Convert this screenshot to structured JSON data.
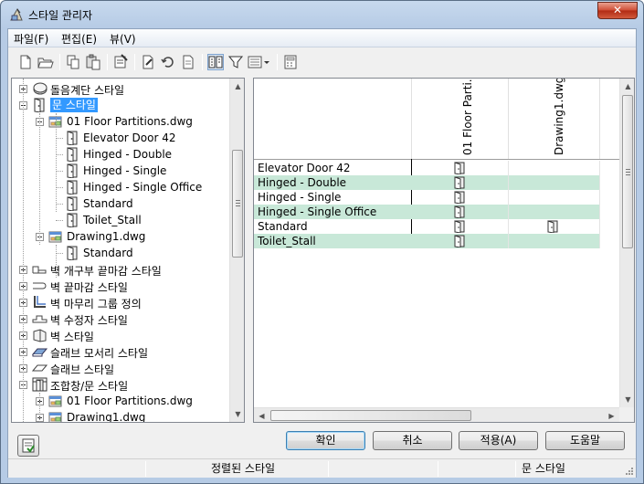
{
  "window": {
    "title": "스타일 관리자",
    "close_label": "✕"
  },
  "menu": [
    "파일(F)",
    "편집(E)",
    "뷰(V)"
  ],
  "tree": [
    {
      "label": "돌음계단 스타일",
      "level": 1,
      "expander": "plus",
      "icon": "stair-icon",
      "partial": true
    },
    {
      "label": "문 스타일",
      "level": 1,
      "expander": "minus",
      "icon": "door-icon",
      "selected": true
    },
    {
      "label": "01 Floor Partitions.dwg",
      "level": 2,
      "expander": "minus",
      "icon": "drawing-file-icon"
    },
    {
      "label": "Elevator Door 42",
      "level": 3,
      "icon": "door-icon"
    },
    {
      "label": "Hinged - Double",
      "level": 3,
      "icon": "door-icon"
    },
    {
      "label": "Hinged - Single",
      "level": 3,
      "icon": "door-icon"
    },
    {
      "label": "Hinged - Single Office",
      "level": 3,
      "icon": "door-icon"
    },
    {
      "label": "Standard",
      "level": 3,
      "icon": "door-icon"
    },
    {
      "label": "Toilet_Stall",
      "level": 3,
      "icon": "door-icon"
    },
    {
      "label": "Drawing1.dwg",
      "level": 2,
      "expander": "minus",
      "icon": "drawing-file-icon"
    },
    {
      "label": "Standard",
      "level": 3,
      "icon": "door-icon"
    },
    {
      "label": "벽 개구부 끝마감 스타일",
      "level": 1,
      "expander": "plus",
      "icon": "wall-opening-icon"
    },
    {
      "label": "벽 끝마감 스타일",
      "level": 1,
      "expander": "plus",
      "icon": "wall-endcap-icon"
    },
    {
      "label": "벽 마무리 그룹 정의",
      "level": 1,
      "expander": "plus",
      "icon": "wall-cleanup-icon"
    },
    {
      "label": "벽 수정자 스타일",
      "level": 1,
      "expander": "plus",
      "icon": "wall-modifier-icon"
    },
    {
      "label": "벽 스타일",
      "level": 1,
      "expander": "plus",
      "icon": "wall-icon"
    },
    {
      "label": "슬래브 모서리 스타일",
      "level": 1,
      "expander": "plus",
      "icon": "slab-edge-icon"
    },
    {
      "label": "슬래브 스타일",
      "level": 1,
      "expander": "plus",
      "icon": "slab-icon"
    },
    {
      "label": "조합창/문 스타일",
      "level": 1,
      "expander": "minus",
      "icon": "door-window-assembly-icon"
    },
    {
      "label": "01 Floor Partitions.dwg",
      "level": 2,
      "expander": "plus",
      "icon": "drawing-file-icon"
    },
    {
      "label": "Drawing1.dwg",
      "level": 2,
      "expander": "plus",
      "icon": "drawing-file-icon"
    }
  ],
  "grid": {
    "columns": [
      "01 Floor Parti...",
      "Drawing1.dwg"
    ],
    "rows": [
      {
        "name": "Elevator Door 42",
        "cells": [
          true,
          false
        ]
      },
      {
        "name": "Hinged - Double",
        "cells": [
          true,
          false
        ]
      },
      {
        "name": "Hinged - Single",
        "cells": [
          true,
          false
        ]
      },
      {
        "name": "Hinged - Single Office",
        "cells": [
          true,
          false
        ]
      },
      {
        "name": "Standard",
        "cells": [
          true,
          true
        ]
      },
      {
        "name": "Toilet_Stall",
        "cells": [
          true,
          false
        ]
      }
    ],
    "alt_row_color": "#c8e8d8"
  },
  "buttons": {
    "ok": "확인",
    "cancel": "취소",
    "apply": "적용(A)",
    "help": "도움말"
  },
  "status": {
    "left": "정렬된 스타일",
    "right": "문 스타일"
  },
  "colors": {
    "selection": "#3399ff",
    "title_gradient_top": "#c7d9ee",
    "close_red": "#c9452d"
  }
}
